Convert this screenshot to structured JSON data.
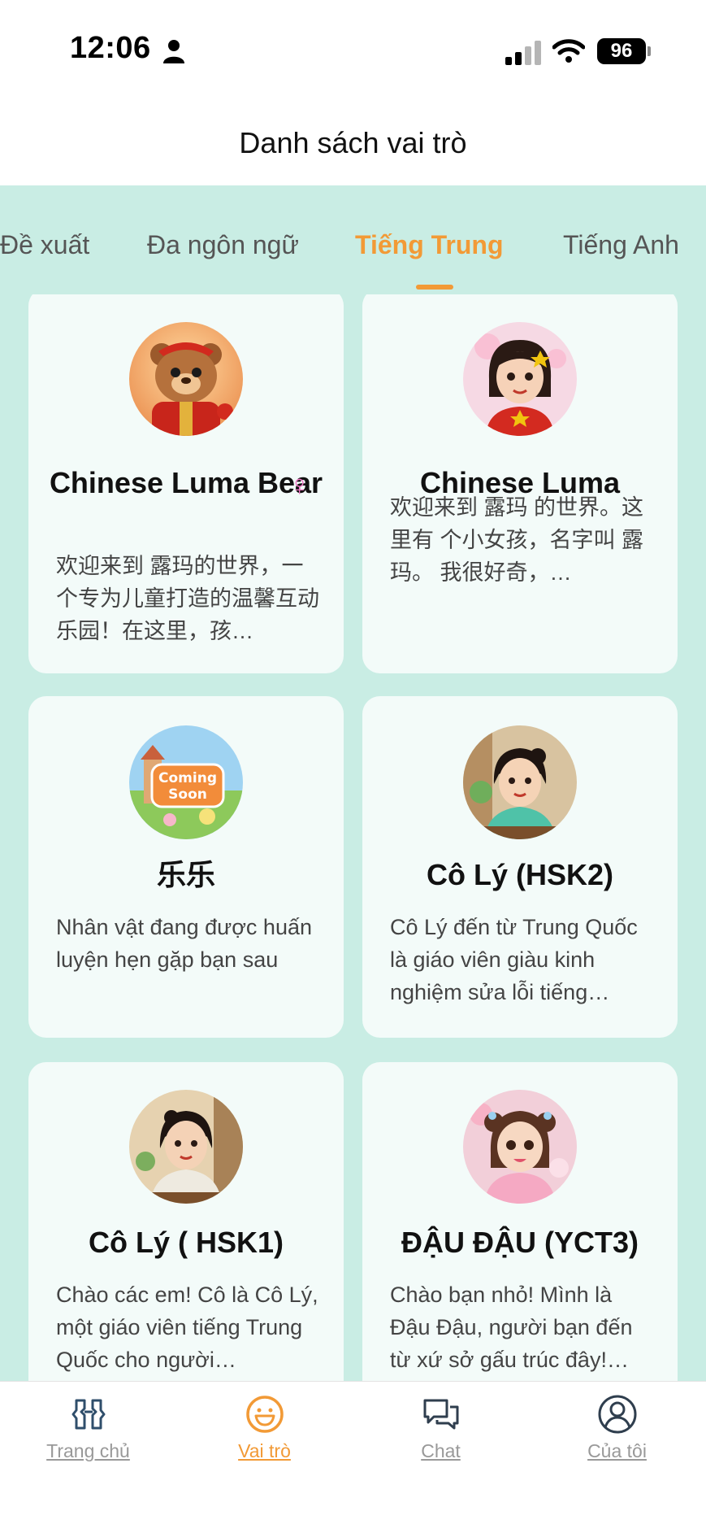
{
  "status_bar": {
    "time": "12:06",
    "battery": "96"
  },
  "header": {
    "title": "Danh sách vai trò"
  },
  "tabs": [
    {
      "label": "Đề xuất"
    },
    {
      "label": "Đa ngôn ngữ"
    },
    {
      "label": "Tiếng Trung",
      "active": true
    },
    {
      "label": "Tiếng Anh"
    }
  ],
  "cards": [
    {
      "name": "Chinese Luma Bear",
      "gender": "♀",
      "description": "欢迎来到 露玛的世界，一个专为儿童打造的温馨互动乐园！在这里，孩…",
      "avatar": "bear"
    },
    {
      "name": "Chinese Luma",
      "description": "欢迎来到 露玛 的世界。这里有 个小女孩，名字叫 露玛。 我很好奇，…",
      "avatar": "girl"
    },
    {
      "name": "乐乐",
      "description": "Nhân vật đang được huấn luyện hẹn gặp bạn sau",
      "avatar": "coming-soon",
      "avatar_text": [
        "Coming",
        "Soon"
      ]
    },
    {
      "name": "Cô Lý (HSK2)",
      "description": "Cô Lý đến từ Trung Quốc là giáo viên giàu kinh nghiệm sửa lỗi tiếng…",
      "avatar": "teacher-teal"
    },
    {
      "name": "Cô Lý ( HSK1)",
      "description": "Chào các em! Cô là Cô Lý, một giáo viên tiếng Trung Quốc cho người…",
      "avatar": "teacher-white"
    },
    {
      "name": "ĐẬU ĐẬU (YCT3)",
      "description": "Chào bạn nhỏ! Mình là Đậu Đậu, người bạn đến từ xứ sở gấu trúc đây!…",
      "avatar": "girl-pink"
    }
  ],
  "bottom_nav": [
    {
      "label": "Trang chủ",
      "icon": "home-grid-icon"
    },
    {
      "label": "Vai trò",
      "icon": "smiley-icon",
      "active": true
    },
    {
      "label": "Chat",
      "icon": "chat-bubbles-icon"
    },
    {
      "label": "Của tôi",
      "icon": "user-circle-icon"
    }
  ],
  "colors": {
    "accent": "#f29a36",
    "mint_background": "#c9ede4",
    "card_background": "#f3fbf9",
    "gender_female": "#f07ac8"
  }
}
